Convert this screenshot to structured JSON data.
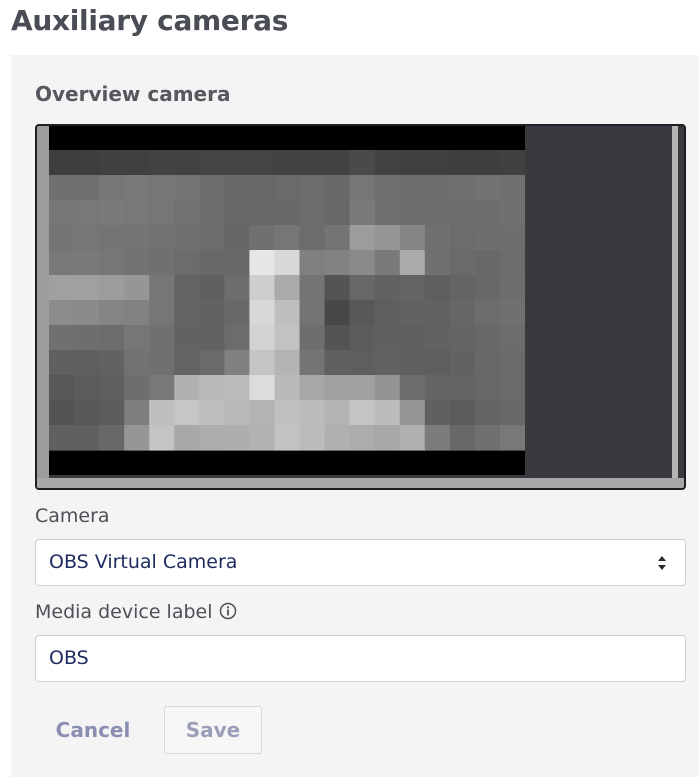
{
  "page": {
    "title": "Auxiliary cameras"
  },
  "camera_panel": {
    "section_title": "Overview camera",
    "camera_label": "Camera",
    "camera_selected": "OBS Virtual Camera",
    "media_label": "Media device label",
    "media_value": "OBS",
    "cancel_label": "Cancel",
    "save_label": "Save"
  },
  "icons": {
    "info": "info-circle-icon",
    "select_arrows": "sort-arrows-icon"
  },
  "colors": {
    "title_text": "#4a4d55",
    "panel_bg": "#f4f4f4",
    "input_text": "#1f2a5e",
    "button_text": "#8a8fb1",
    "preview_bg": "#383a40"
  }
}
